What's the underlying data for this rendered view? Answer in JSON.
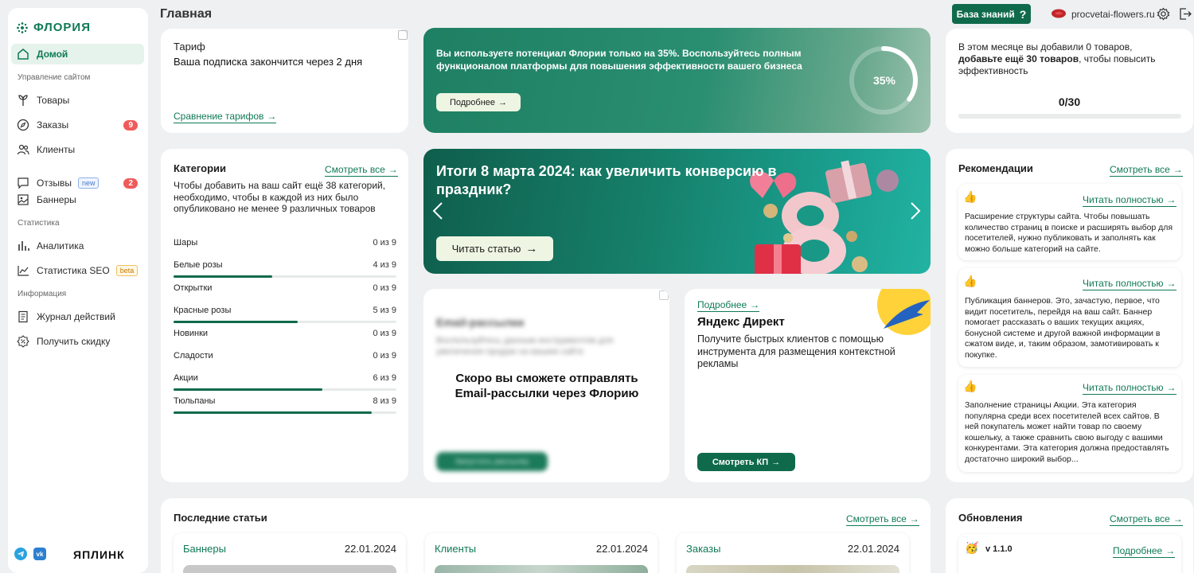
{
  "brand": {
    "name": "ФЛОРИЯ",
    "footer_logo": "ЯПЛИНК"
  },
  "sidebar": {
    "items": [
      {
        "label": "Домой",
        "icon": "home-icon"
      },
      {
        "label": "Товары",
        "icon": "plant-icon"
      },
      {
        "label": "Заказы",
        "icon": "compass-icon",
        "badge": "9"
      },
      {
        "label": "Клиенты",
        "icon": "users-icon"
      },
      {
        "label": "Отзывы",
        "icon": "chat-icon",
        "tag": "new",
        "badge": "2"
      },
      {
        "label": "Баннеры",
        "icon": "image-icon"
      },
      {
        "label": "Аналитика",
        "icon": "bars-icon"
      },
      {
        "label": "Статистика SEO",
        "icon": "trend-icon",
        "tag": "beta"
      },
      {
        "label": "Журнал действий",
        "icon": "journal-icon"
      },
      {
        "label": "Получить скидку",
        "icon": "discount-icon"
      }
    ],
    "sections": [
      "Управление сайтом",
      "Статистика",
      "Информация"
    ]
  },
  "header": {
    "title": "Главная",
    "kb_button": "База знаний",
    "kb_icon": "?",
    "site": "procvetai-flowers.ru"
  },
  "tariff": {
    "title": "Тариф",
    "text": "Ваша подписка закончится через 2 дня",
    "link": "Сравнение тарифов"
  },
  "promo": {
    "text": "Вы используете потенциал Флории только на 35%. Воспользуйтесь полным функционалом платформы для повышения эффективности вашего бизнеса",
    "button": "Подробнее",
    "percent_label": "35%",
    "percent": 35
  },
  "products_progress": {
    "text_line1": "В этом месяце вы добавили 0 товаров,",
    "text_bold": "добавьте ещё 30 товаров",
    "text_line2": ", чтобы повысить эффективность",
    "counter": "0/30",
    "fraction": 0
  },
  "categories": {
    "title": "Категории",
    "see_all": "Смотреть все",
    "description": "Чтобы добавить на ваш сайт ещё 38 категорий, необходимо, чтобы в каждой из них было опубликовано не менее 9 различных товаров",
    "rows": [
      {
        "name": "Шары",
        "count": "0 из 9",
        "value": 0
      },
      {
        "name": "Белые розы",
        "count": "4 из 9",
        "value": 4
      },
      {
        "name": "Открытки",
        "count": "0 из 9",
        "value": 0
      },
      {
        "name": "Красные розы",
        "count": "5 из 9",
        "value": 5
      },
      {
        "name": "Новинки",
        "count": "0 из 9",
        "value": 0
      },
      {
        "name": "Сладости",
        "count": "0 из 9",
        "value": 0
      },
      {
        "name": "Акции",
        "count": "6 из 9",
        "value": 6
      },
      {
        "name": "Тюльпаны",
        "count": "8 из 9",
        "value": 8
      }
    ],
    "max": 9
  },
  "banner": {
    "title": "Итоги 8 марта 2024: как увеличить конверсию в праздник?",
    "button": "Читать статью",
    "digit": "8"
  },
  "email": {
    "blur_title": "Email-рассылки",
    "blur_text": "Воспользуйтесь данным инструментом для увеличения продаж на вашем сайте",
    "message": "Скоро вы сможете отправлять Email-рассылки через Флорию",
    "blur_button": "Запустить рассылку"
  },
  "direct": {
    "link": "Подробнее",
    "title": "Яндекс Директ",
    "text": "Получите быстрых клиентов с помощью инструмента для размещения контекстной рекламы",
    "button": "Смотреть КП"
  },
  "recommendations": {
    "title": "Рекомендации",
    "see_all": "Смотреть все",
    "items": [
      {
        "link": "Читать полностью",
        "text": "Расширение структуры сайта. Чтобы повышать количество страниц в поиске и расширять выбор для посетителей, нужно публиковать и заполнять как можно больше категорий на сайте."
      },
      {
        "link": "Читать полностью",
        "text": "Публикация баннеров. Это, зачастую, первое, что видит посетитель, перейдя на ваш сайт. Баннер помогает рассказать о ваших текущих акциях, бонусной системе и другой важной информации в сжатом виде, и, таким образом, замотивировать к покупке."
      },
      {
        "link": "Читать полностью",
        "text": "Заполнение страницы Акции. Эта категория популярна среди всех посетителей всех сайтов. В ней покупатель может найти товар по своему кошельку, а также сравнить свою выгоду с вашими конкурентами. Эта категория должна предоставлять достаточно широкий выбор..."
      }
    ]
  },
  "articles": {
    "title": "Последние статьи",
    "see_all": "Смотреть все",
    "items": [
      {
        "category": "Баннеры",
        "date": "22.01.2024"
      },
      {
        "category": "Клиенты",
        "date": "22.01.2024"
      },
      {
        "category": "Заказы",
        "date": "22.01.2024"
      }
    ]
  },
  "updates": {
    "title": "Обновления",
    "see_all": "Смотреть все",
    "version": "v 1.1.0",
    "link": "Подробнее"
  },
  "colors": {
    "accent": "#0f6a4b",
    "badge": "#f05a5a",
    "background": "#eef0f1"
  }
}
